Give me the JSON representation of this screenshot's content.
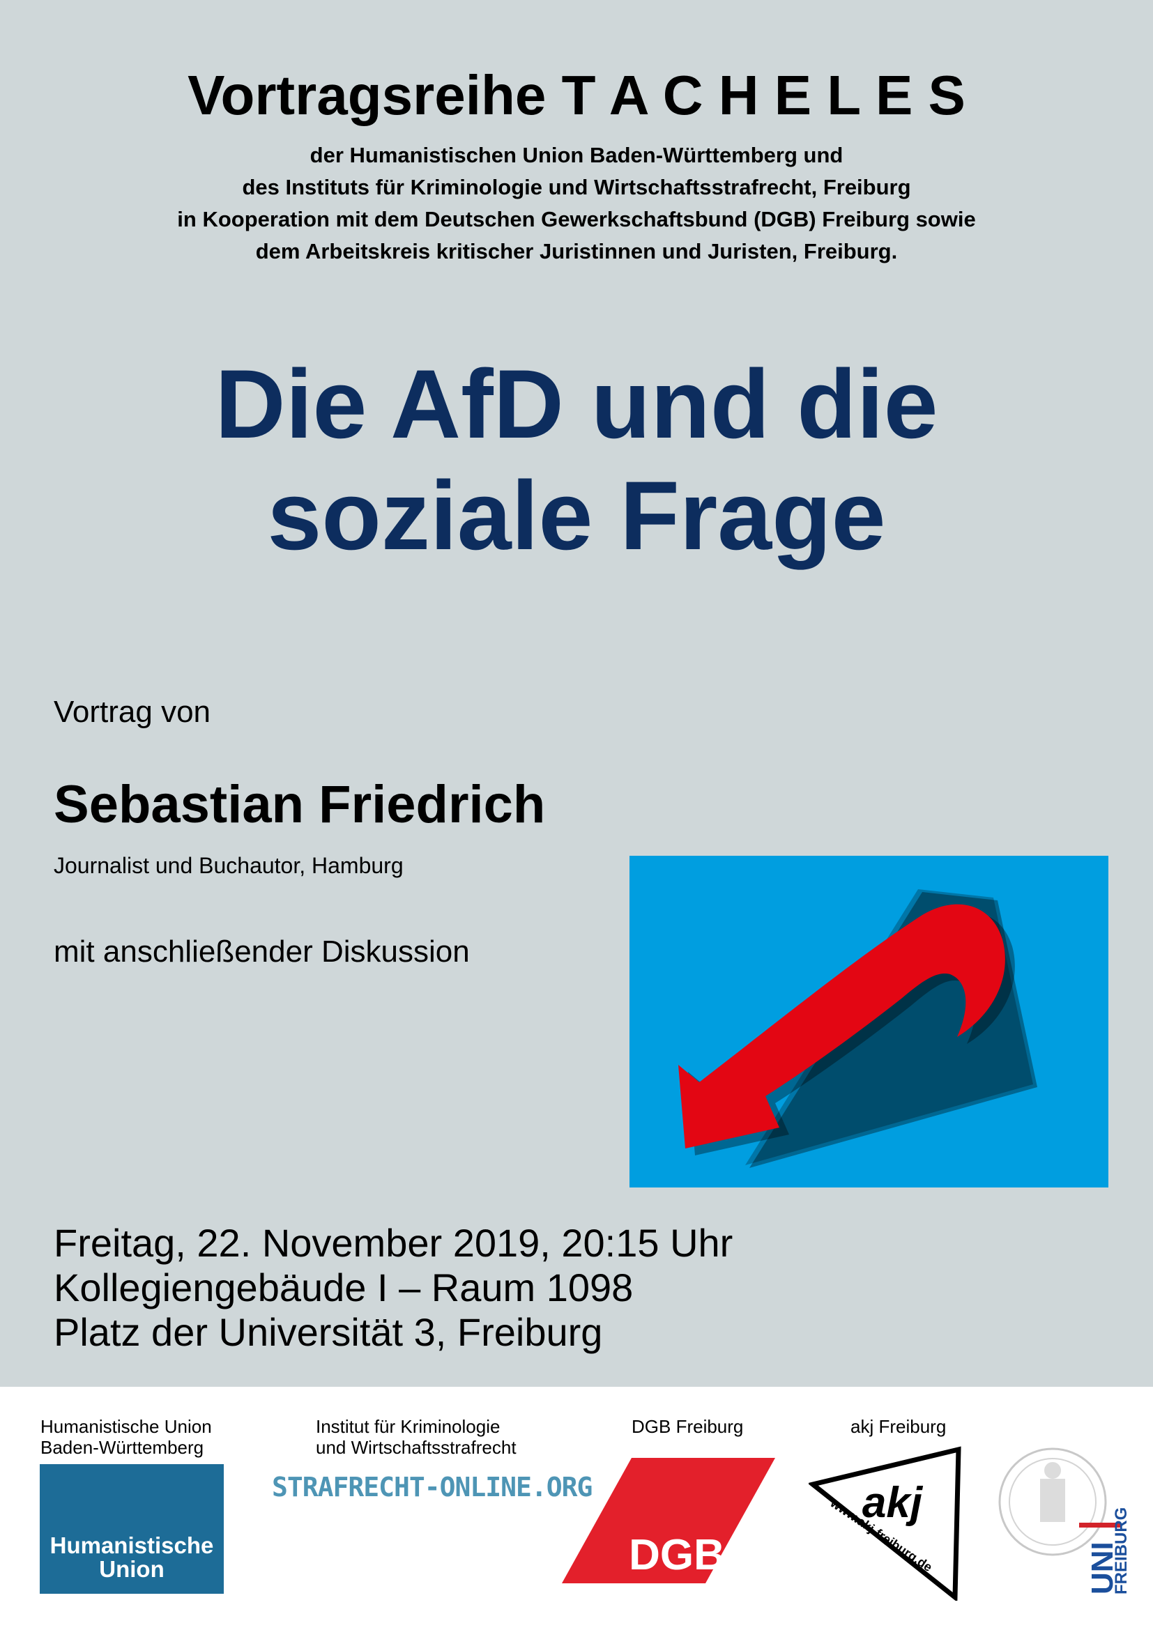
{
  "header": {
    "series_title": "Vortragsreihe T A C H E L E S",
    "org_lines": [
      "der Humanistischen Union Baden-Württemberg und",
      "des Instituts für Kriminologie und Wirtschaftsstrafrecht, Freiburg",
      "in Kooperation mit dem Deutschen Gewerkschaftsbund (DGB) Freiburg sowie",
      "dem Arbeitskreis kritischer Juristinnen und Juristen, Freiburg."
    ]
  },
  "main_title": {
    "line1": "Die AfD und die",
    "line2": "soziale Frage",
    "color": "#0d2d5e"
  },
  "lecture": {
    "intro": "Vortrag von",
    "speaker": "Sebastian Friedrich",
    "speaker_role": "Journalist und Buchautor, Hamburg",
    "discussion": "mit anschließender Diskussion"
  },
  "event": {
    "date_time": "Freitag, 22. November 2019, 20:15 Uhr",
    "room": "Kollegiengebäude I – Raum 1098",
    "address": "Platz der Universität 3, Freiburg"
  },
  "footer": {
    "hu_label_line1": "Humanistische Union",
    "hu_label_line2": "Baden-Württemberg",
    "hu_logo_line1": "Humanistische",
    "hu_logo_line2": "Union",
    "ikw_label_line1": "Institut für Kriminologie",
    "ikw_label_line2": "und Wirtschaftsstrafrecht",
    "strafrecht_logo": "STRAFRECHT-ONLINE.ORG",
    "dgb_label": "DGB Freiburg",
    "dgb_logo": "DGB",
    "akj_label": "akj Freiburg",
    "akj_logo": "akj",
    "akj_url": "www.akj-freiburg.de",
    "uni_logo_line1": "UNI",
    "uni_logo_line2": "FREIBURG"
  },
  "colors": {
    "poster_background": "#cfd7d9",
    "afd_blue": "#009ee0",
    "afd_red": "#e30613",
    "hu_blue": "#1d6c97",
    "strafrecht_blue": "#4e95b5",
    "dgb_red": "#e3202b",
    "uni_blue": "#1b4f9c"
  }
}
